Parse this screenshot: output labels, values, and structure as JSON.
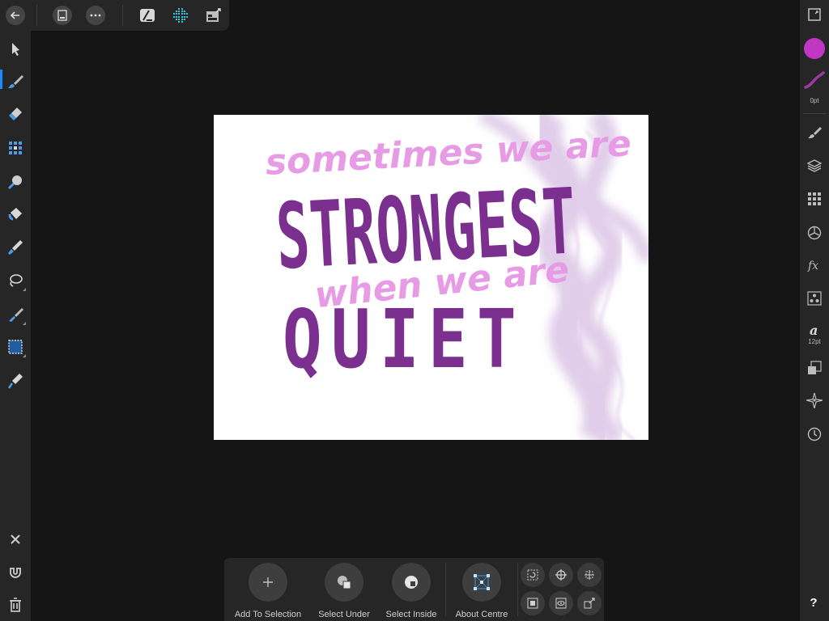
{
  "artwork": {
    "line1": "sometimes we are",
    "line2": "STRONGEST",
    "line3": "when we are",
    "line4": "QUIET",
    "colors": {
      "light": "#e69be4",
      "dark": "#7b2f8e",
      "smoke": "#c8a6d8"
    }
  },
  "studio": {
    "fill_color": "#c137c4",
    "stroke_color": "#9d3aa0",
    "stroke_width": "0pt",
    "font_size": "12pt"
  },
  "context_toolbar": {
    "add_to_selection": "Add To Selection",
    "select_under": "Select Under",
    "select_inside": "Select Inside",
    "about_centre": "About Centre"
  },
  "help": {
    "label": "?"
  }
}
